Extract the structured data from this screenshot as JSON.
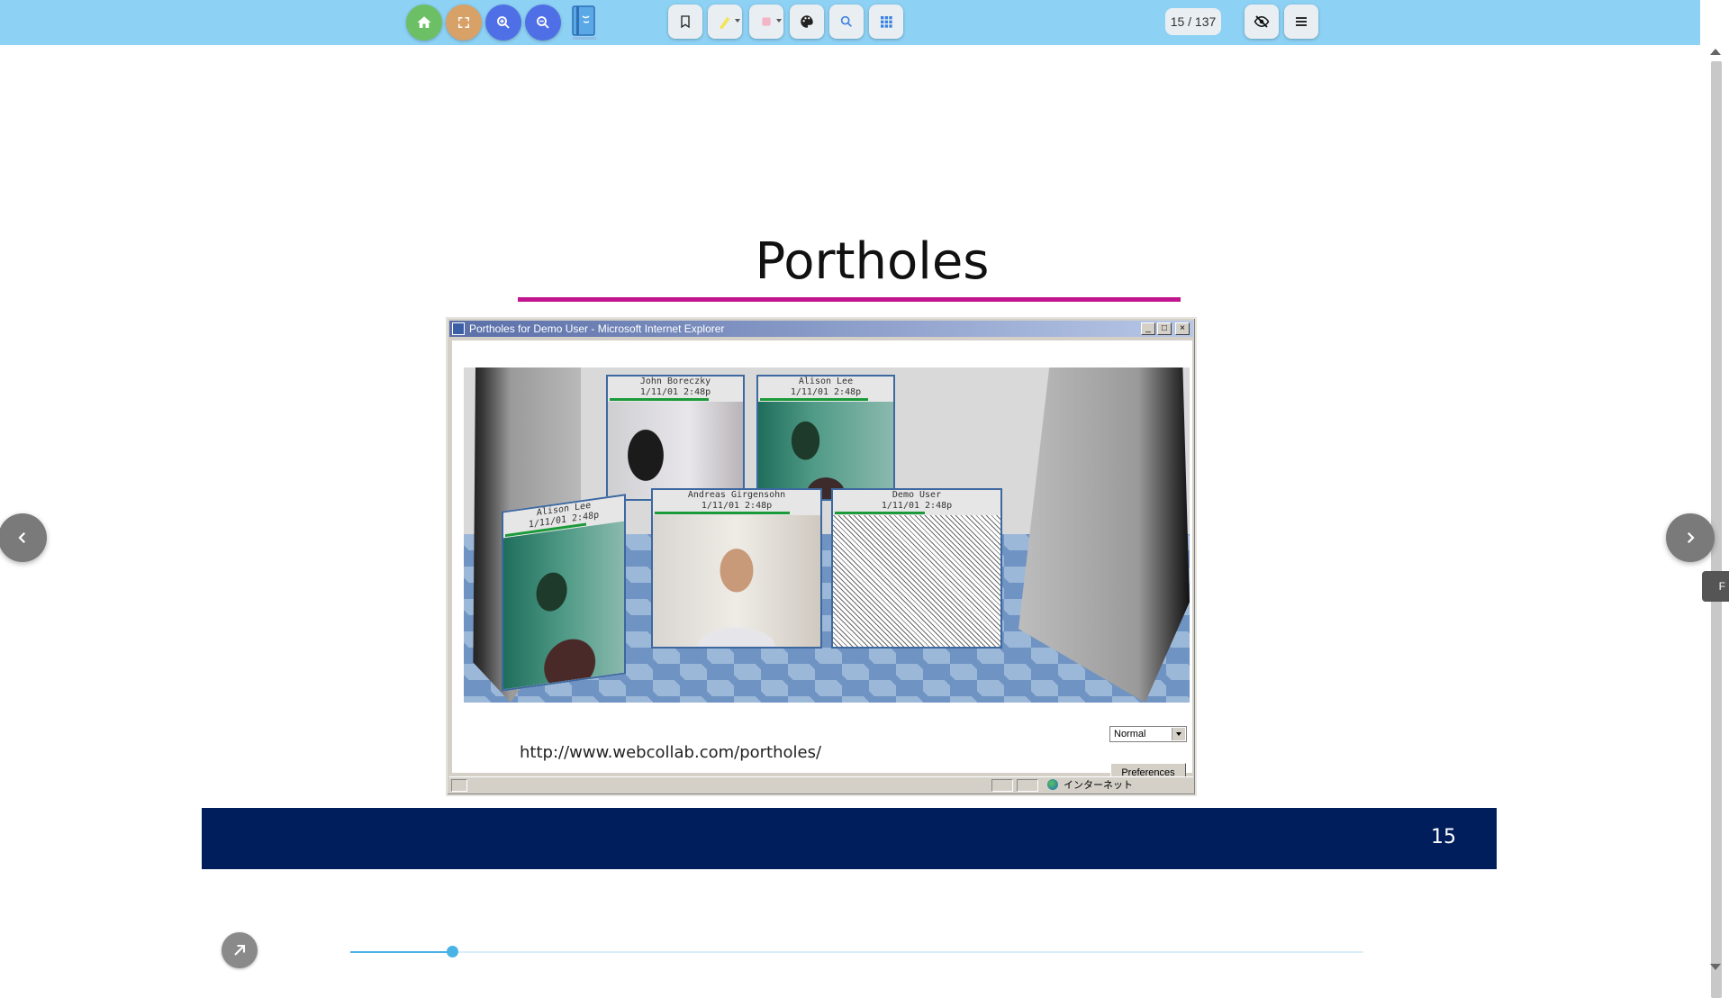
{
  "toolbar": {
    "page_indicator": "15 / 137",
    "colors": {
      "home": "#6dbf66",
      "fullscreen": "#d8a167",
      "zoom_in": "#4f6fe6",
      "zoom_out": "#4f6fe6"
    },
    "icons": [
      "home-icon",
      "fullscreen-icon",
      "zoom-in-icon",
      "zoom-out-icon",
      "book-logo-icon",
      "bookmark-icon",
      "highlighter-icon",
      "eraser-icon",
      "palette-icon",
      "search-icon",
      "grid-icon",
      "eye-off-icon",
      "menu-icon"
    ]
  },
  "slide": {
    "title": "Portholes",
    "accent_color": "#c0158c",
    "footer_color": "#001e5c",
    "slide_number": "15",
    "url_caption": "http://www.webcollab.com/portholes/"
  },
  "ie_window": {
    "title": "Portholes for Demo User - Microsoft Internet Explorer",
    "view_select": "Normal",
    "preferences_button": "Preferences",
    "status_zone": "インターネット",
    "portholes": [
      {
        "name": "John Boreczky",
        "time": "1/11/01 2:48p"
      },
      {
        "name": "Alison Lee",
        "time": "1/11/01 2:48p"
      },
      {
        "name": "Alison Lee",
        "time": "1/11/01 2:48p"
      },
      {
        "name": "Andreas Girgensohn",
        "time": "1/11/01 2:48p"
      },
      {
        "name": "Demo User",
        "time": "1/11/01 2:48p"
      }
    ]
  },
  "side_tab": {
    "label": "F"
  },
  "progress": {
    "current_page": 15,
    "total_pages": 137,
    "fraction": 0.1
  }
}
